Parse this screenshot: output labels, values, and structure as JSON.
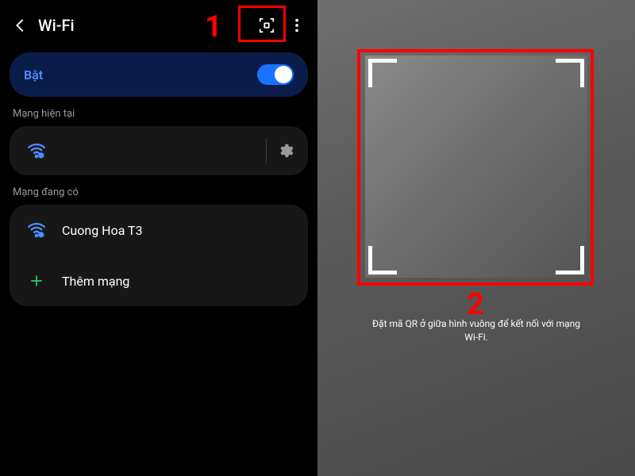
{
  "left": {
    "title": "Wi-Fi",
    "toggle": {
      "label": "Bật",
      "state": true
    },
    "current_section": "Mạng hiện tại",
    "current_network": {
      "name": ""
    },
    "available_section": "Mạng đang có",
    "networks": [
      {
        "name": "Cuong Hoa T3"
      }
    ],
    "add_network": "Thêm mạng"
  },
  "right": {
    "caption": "Đặt mã QR ở giữa hình vuông để kết nối với mạng Wi-Fi."
  },
  "annotations": {
    "step1": "1",
    "step2": "2"
  }
}
